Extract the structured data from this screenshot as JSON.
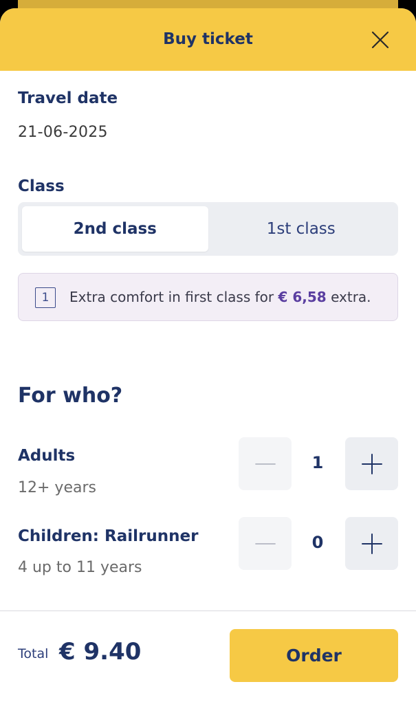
{
  "header": {
    "title": "Buy ticket"
  },
  "travel_date": {
    "label": "Travel date",
    "value": "21-06-2025"
  },
  "class_selector": {
    "label": "Class",
    "options": [
      "2nd class",
      "1st class"
    ],
    "selected": "2nd class"
  },
  "info": {
    "icon_text": "1",
    "text_before": "Extra comfort in first class for",
    "price": "€ 6,58",
    "text_after": "extra."
  },
  "passengers": {
    "title": "For who?",
    "rows": [
      {
        "title": "Adults",
        "subtitle": "12+ years",
        "count": "1"
      },
      {
        "title": "Children: Railrunner",
        "subtitle": "4 up to 11 years",
        "count": "0"
      }
    ]
  },
  "footer": {
    "total_label": "Total",
    "total_value": "€ 9.40",
    "order_label": "Order"
  },
  "colors": {
    "brand_yellow": "#f6c945",
    "navy": "#1f3366",
    "info_bg": "#f3eef6",
    "info_price": "#5a3ea0"
  }
}
